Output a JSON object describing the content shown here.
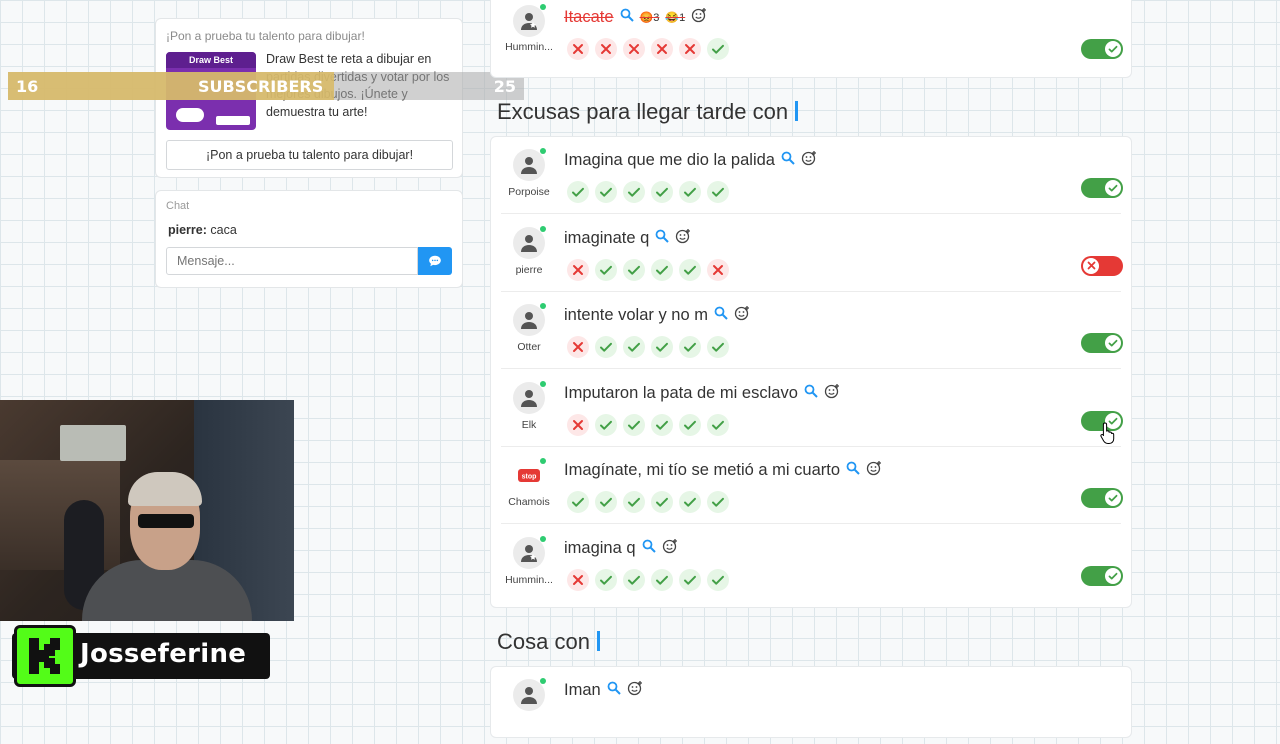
{
  "promo": {
    "title": "¡Pon a prueba tu talento para dibujar!",
    "image_label": "Draw Best",
    "description": "Draw Best te reta a dibujar en partidas divertidas y votar por los mejores dibujos. ¡Únete y demuestra tu arte!",
    "button_label": "¡Pon a prueba tu talento para dibujar!"
  },
  "overlay": {
    "subscriber_count": "16",
    "subscribers_label": "SUBSCRIBERS",
    "subscriber_goal": "25"
  },
  "chat": {
    "title": "Chat",
    "messages": [
      {
        "user": "pierre:",
        "text": "caca"
      }
    ],
    "input_placeholder": "Mensaje..."
  },
  "streamer": {
    "name": "Josseferine",
    "platform_logo": "kick-logo"
  },
  "top_row": {
    "user": "Hummin...",
    "answer": "Itacate",
    "reactions": [
      {
        "emoji": "😡",
        "count": "3"
      },
      {
        "emoji": "😂",
        "count": "1"
      }
    ],
    "votes": [
      "no",
      "no",
      "no",
      "no",
      "no",
      "yes"
    ],
    "accepted": true
  },
  "sections": [
    {
      "title": "Excusas para llegar tarde con",
      "rows": [
        {
          "user": "Porpoise",
          "answer": "Imagina que me dio la palida",
          "votes": [
            "yes",
            "yes",
            "yes",
            "yes",
            "yes",
            "yes"
          ],
          "accepted": true,
          "avatar": "person"
        },
        {
          "user": "pierre",
          "answer": "imaginate q",
          "votes": [
            "no",
            "yes",
            "yes",
            "yes",
            "yes",
            "no"
          ],
          "accepted": false,
          "avatar": "person"
        },
        {
          "user": "Otter",
          "answer": "intente volar y no m",
          "votes": [
            "no",
            "yes",
            "yes",
            "yes",
            "yes",
            "yes"
          ],
          "accepted": true,
          "avatar": "person"
        },
        {
          "user": "Elk",
          "answer": "Imputaron la pata de mi esclavo",
          "votes": [
            "no",
            "yes",
            "yes",
            "yes",
            "yes",
            "yes"
          ],
          "accepted": true,
          "avatar": "person"
        },
        {
          "user": "Chamois",
          "answer": "Imagínate, mi tío se metió a mi cuarto",
          "votes": [
            "yes",
            "yes",
            "yes",
            "yes",
            "yes",
            "yes"
          ],
          "accepted": true,
          "avatar": "stop"
        },
        {
          "user": "Hummin...",
          "answer": "imagina q",
          "votes": [
            "no",
            "yes",
            "yes",
            "yes",
            "yes",
            "yes"
          ],
          "accepted": true,
          "avatar": "person-star"
        }
      ]
    },
    {
      "title": "Cosa con",
      "rows": [
        {
          "user": "",
          "answer": "Iman",
          "votes": [],
          "accepted": true,
          "avatar": "person"
        }
      ]
    }
  ],
  "colors": {
    "accent": "#2196f3",
    "accept": "#43a047",
    "reject": "#e53935",
    "kick_green": "#53fc18",
    "subs_bar": "#d6b96c"
  }
}
